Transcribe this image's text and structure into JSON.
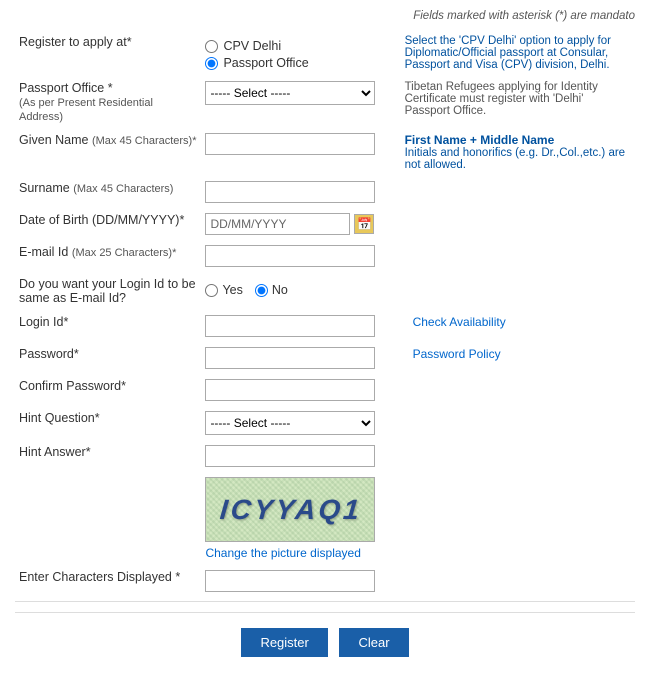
{
  "page": {
    "top_note": "Fields marked with asterisk (*) are mandato",
    "register_label": "Register to apply at*",
    "passport_office_label": "Passport Office *",
    "passport_office_sublabel": "(As per Present Residential Address)",
    "given_name_label": "Given Name",
    "given_name_sublabel": "(Max 45 Characters)*",
    "surname_label": "Surname",
    "surname_sublabel": "(Max 45 Characters)",
    "dob_label": "Date of Birth (DD/MM/YYYY)*",
    "email_label": "E-mail Id",
    "email_sublabel": "(Max 25 Characters)*",
    "login_same_label": "Do you want your Login Id",
    "login_same_label2": " to be same as E-mail Id?",
    "login_id_label": "Login Id*",
    "password_label": "Password*",
    "confirm_password_label": "Confirm Password*",
    "hint_question_label": "Hint Question*",
    "hint_answer_label": "Hint Answer*",
    "enter_characters_label": "Enter Characters Displayed *",
    "cpv_delhi_label": "CPV Delhi",
    "passport_office_radio_label": "Passport Office",
    "select_placeholder": "----- Select -----",
    "dob_placeholder": "DD/MM/YYYY",
    "yes_label": "Yes",
    "no_label": "No",
    "hint_select_placeholder": "----- Select -----",
    "check_availability": "Check Availability",
    "password_policy": "Password Policy",
    "change_picture": "Change the picture displayed",
    "register_btn": "Register",
    "clear_btn": "Clear",
    "cpv_info": "Select the 'CPV Delhi' option to apply for Diplomatic/Official passport at Consular, Passport and Visa (CPV) division, Delhi.",
    "passport_info": "Tibetan Refugees applying for Identity Certificate must register with 'Delhi' Passport Office.",
    "name_info_bold": "First Name + Middle Name",
    "name_info": "Initials and honorifics (e.g. Dr.,Col.,etc.) are not allowed.",
    "captcha_text": "ICYYAQ1"
  }
}
